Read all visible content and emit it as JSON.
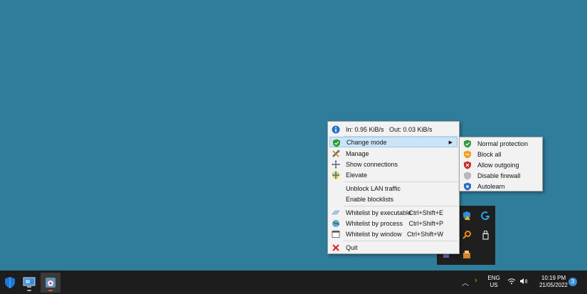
{
  "menu": {
    "stats": "In: 0.95 KiB/s   Out: 0.03 KiB/s",
    "change_mode": "Change mode",
    "manage": "Manage",
    "show_connections": "Show connections",
    "elevate": "Elevate",
    "unblock_lan": "Unblock LAN traffic",
    "enable_blocklists": "Enable blocklists",
    "whitelist_exe": {
      "label": "Whitelist by executable",
      "shortcut": "Ctrl+Shift+E"
    },
    "whitelist_proc": {
      "label": "Whitelist by process",
      "shortcut": "Ctrl+Shift+P"
    },
    "whitelist_win": {
      "label": "Whitelist by window",
      "shortcut": "Ctrl+Shift+W"
    },
    "quit": "Quit"
  },
  "submenu": {
    "normal": "Normal protection",
    "block_all": "Block all",
    "allow_outgoing": "Allow outgoing",
    "disable_firewall": "Disable firewall",
    "autolearn": "Autolearn"
  },
  "taskbar": {
    "lang_top": "ENG",
    "lang_bottom": "US",
    "time": "10:19 PM",
    "date": "21/05/2022",
    "notifications": "3"
  },
  "colors": {
    "desktop": "#2f7c9b",
    "menu_bg": "#f2f2f2",
    "highlight": "#cce4f7",
    "taskbar": "#1d1d1d"
  }
}
